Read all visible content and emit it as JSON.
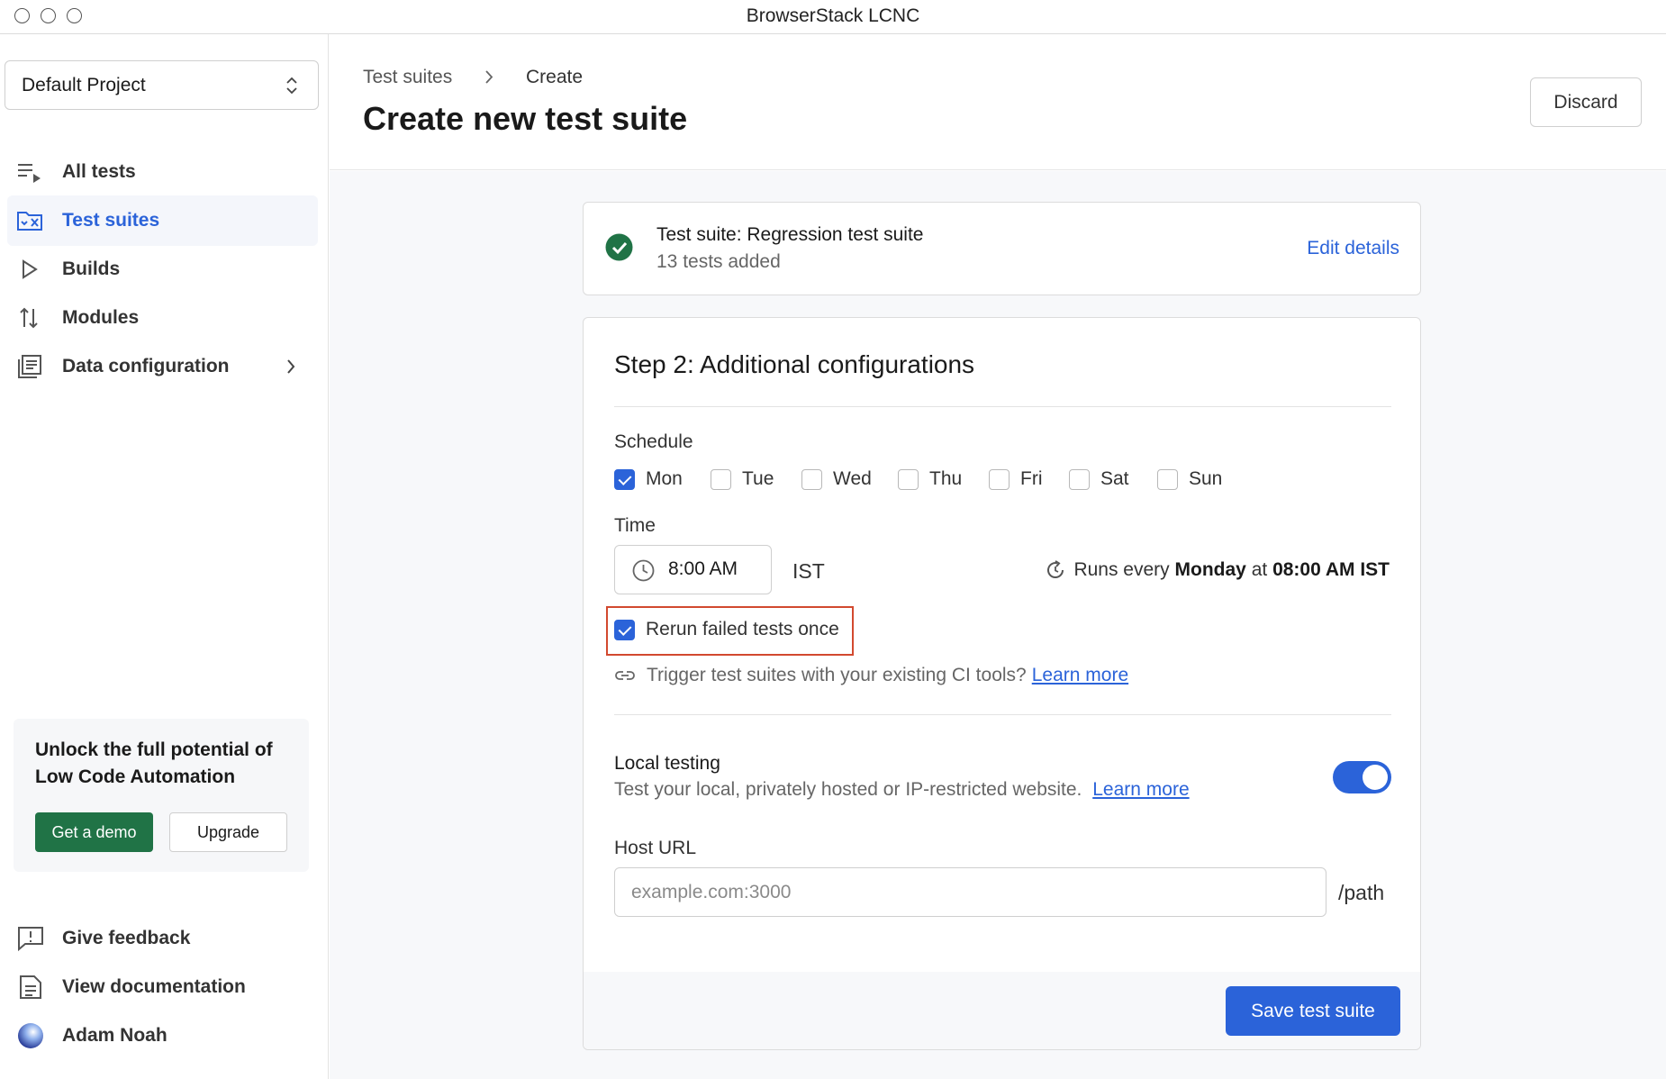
{
  "window": {
    "title": "BrowserStack LCNC"
  },
  "sidebar": {
    "project": "Default Project",
    "items": [
      {
        "label": "All tests",
        "icon": "list-play-icon"
      },
      {
        "label": "Test suites",
        "icon": "test-suite-icon",
        "active": true
      },
      {
        "label": "Builds",
        "icon": "play-icon"
      },
      {
        "label": "Modules",
        "icon": "sort-arrows-icon"
      },
      {
        "label": "Data configuration",
        "icon": "data-config-icon",
        "has_submenu": true
      }
    ],
    "promo": {
      "text": "Unlock the full potential of Low Code Automation",
      "demo_label": "Get a demo",
      "upgrade_label": "Upgrade"
    },
    "footer": [
      {
        "label": "Give feedback",
        "icon": "feedback-icon"
      },
      {
        "label": "View documentation",
        "icon": "document-icon"
      },
      {
        "label": "Adam Noah",
        "icon": "avatar"
      }
    ]
  },
  "header": {
    "breadcrumb": [
      "Test suites",
      "Create"
    ],
    "title": "Create new test suite",
    "discard_label": "Discard"
  },
  "summary": {
    "title": "Test suite: Regression test suite",
    "subtitle": "13 tests added",
    "edit_label": "Edit details"
  },
  "step": {
    "title": "Step 2: Additional configurations",
    "schedule_label": "Schedule",
    "days": [
      {
        "label": "Mon",
        "checked": true
      },
      {
        "label": "Tue",
        "checked": false
      },
      {
        "label": "Wed",
        "checked": false
      },
      {
        "label": "Thu",
        "checked": false
      },
      {
        "label": "Fri",
        "checked": false
      },
      {
        "label": "Sat",
        "checked": false
      },
      {
        "label": "Sun",
        "checked": false
      }
    ],
    "time_label": "Time",
    "time_value": "8:00 AM",
    "timezone": "IST",
    "runs_prefix": "Runs every",
    "runs_day": "Monday",
    "runs_at": "at",
    "runs_time": "08:00 AM IST",
    "rerun_label": "Rerun failed tests once",
    "rerun_checked": true,
    "ci_text": "Trigger test suites with your existing CI tools?",
    "ci_link": "Learn more",
    "local_title": "Local testing",
    "local_desc": "Test your local, privately hosted or IP-restricted website.",
    "local_link": "Learn more",
    "local_enabled": true,
    "host_label": "Host URL",
    "host_value": "",
    "host_placeholder": "example.com:3000",
    "host_suffix": "/path",
    "save_label": "Save test suite"
  },
  "colors": {
    "accent": "#2b63d9",
    "success": "#207346",
    "highlight": "#d2492f"
  }
}
